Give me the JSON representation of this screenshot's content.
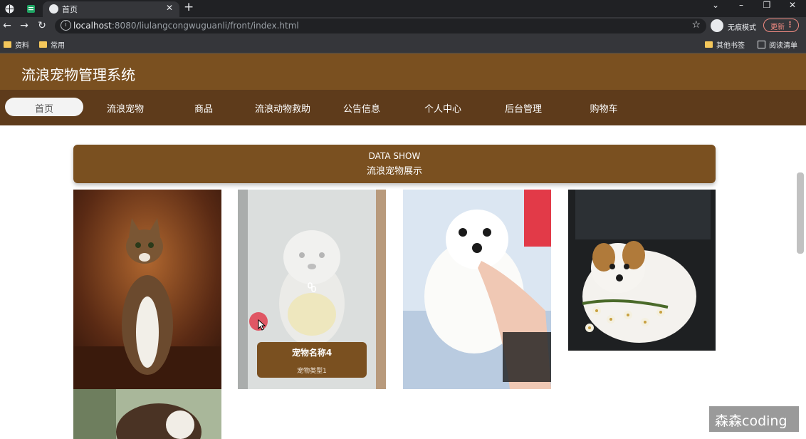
{
  "browser": {
    "tab_title": "首页",
    "url_host": "localhost",
    "url_rest": ":8080/liulangcongwuguanli/front/index.html",
    "profile_label": "无痕模式",
    "update_label": "更新",
    "bookmarks": [
      "资料",
      "常用"
    ],
    "bookmarks_right": [
      "其他书签",
      "阅读清单"
    ]
  },
  "site": {
    "title": "流浪宠物管理系统",
    "nav": [
      {
        "label": "首页",
        "active": true
      },
      {
        "label": "流浪宠物"
      },
      {
        "label": "商品"
      },
      {
        "label": "流浪动物救助"
      },
      {
        "label": "公告信息"
      },
      {
        "label": "个人中心"
      },
      {
        "label": "后台管理"
      },
      {
        "label": "购物车"
      }
    ]
  },
  "section": {
    "title_en": "DATA SHOW",
    "title_cn": "流浪宠物展示"
  },
  "cards": [
    {
      "image": "tabby-cat-photo"
    },
    {
      "image": "white-puppy-photo",
      "hover_name": "宠物名称4",
      "hover_type": "宠物类型1"
    },
    {
      "image": "fluffy-white-puppy-photo"
    },
    {
      "image": "jack-russell-with-flowers-photo"
    },
    {
      "image": "cat-photo-partial"
    }
  ],
  "watermark": "森森coding",
  "colors": {
    "header_brown": "#7a5020",
    "nav_brown": "#5e3b1b",
    "chrome_dark": "#202124",
    "chrome_toolbar": "#35363a"
  }
}
